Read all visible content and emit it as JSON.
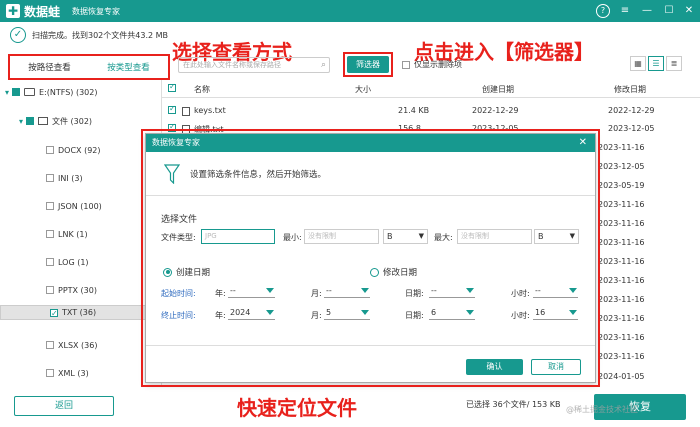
{
  "app": {
    "logo_mark": "✚",
    "logo_text": "数据蛙",
    "title": "数据恢复专家"
  },
  "status": {
    "text": "扫描完成。找到302个文件共43.2 MB"
  },
  "annotations": {
    "view_mode": "选择查看方式",
    "enter_filter": "点击进入【筛选器】",
    "locate": "快速定位文件"
  },
  "view_tabs": {
    "by_path": "按路径查看",
    "by_type": "按类型查看"
  },
  "toolbar": {
    "search_placeholder": "在此处输入文件名称或保存路径",
    "filter_button": "筛选器",
    "only_deleted": "仅显示删除项"
  },
  "sidebar": {
    "items": [
      {
        "label": "E:(NTFS) (302)"
      },
      {
        "label": "文件 (302)"
      },
      {
        "label": "DOCX (92)"
      },
      {
        "label": "INI (3)"
      },
      {
        "label": "JSON (100)"
      },
      {
        "label": "LNK (1)"
      },
      {
        "label": "LOG (1)"
      },
      {
        "label": "PPTX (30)"
      },
      {
        "label": "TXT (36)"
      },
      {
        "label": "XLSX (36)"
      },
      {
        "label": "XML (3)"
      }
    ]
  },
  "table": {
    "headers": {
      "name": "名称",
      "size": "大小",
      "created": "创建日期",
      "modified": "修改日期"
    },
    "rows": [
      {
        "name": "keys.txt",
        "size": "21.4 KB",
        "created": "2022-12-29",
        "modified": "2022-12-29"
      },
      {
        "name": "编辑.txt",
        "size": "156.8",
        "created": "2023-12-05",
        "modified": "2023-12-05"
      }
    ],
    "modified_column": [
      "2023-11-16",
      "2023-12-05",
      "2023-05-19",
      "2023-11-16",
      "2023-11-16",
      "2023-11-16",
      "2023-11-16",
      "2023-11-16",
      "2023-11-16",
      "2023-11-16",
      "2023-11-16",
      "2023-11-16",
      "2023-11-16",
      "2024-01-05"
    ]
  },
  "dialog": {
    "title": "数据恢复专家",
    "close": "✕",
    "header_text": "设置筛选条件信息，然后开始筛选。",
    "section_file": "选择文件",
    "file_type_label": "文件类型:",
    "file_type_placeholder": "JPG",
    "min_label": "最小:",
    "min_placeholder": "没有限制",
    "min_unit": "B",
    "max_label": "最大:",
    "max_placeholder": "没有限制",
    "max_unit": "B",
    "radio_created": "创建日期",
    "radio_modified": "修改日期",
    "start_label": "起始时间:",
    "end_label": "终止时间:",
    "year_label": "年:",
    "month_label": "月:",
    "day_label": "日期:",
    "hour_label": "小时:",
    "start": {
      "year": "--",
      "month": "--",
      "day": "--",
      "hour": "--"
    },
    "end": {
      "year": "2024",
      "month": "5",
      "day": "6",
      "hour": "16"
    },
    "ok": "确认",
    "cancel": "取消"
  },
  "bottom": {
    "back": "返回",
    "selection_info": "已选择 36个文件/ 153 KB",
    "restore": "恢复",
    "watermark": "@稀土掘金技术社区"
  },
  "window_controls": {
    "help": "?",
    "menu": "≡",
    "min": "—",
    "max": "☐",
    "close": "✕"
  },
  "colors": {
    "primary": "#17998f",
    "annotation": "#e8211c",
    "date_label": "#2f6bbf"
  }
}
